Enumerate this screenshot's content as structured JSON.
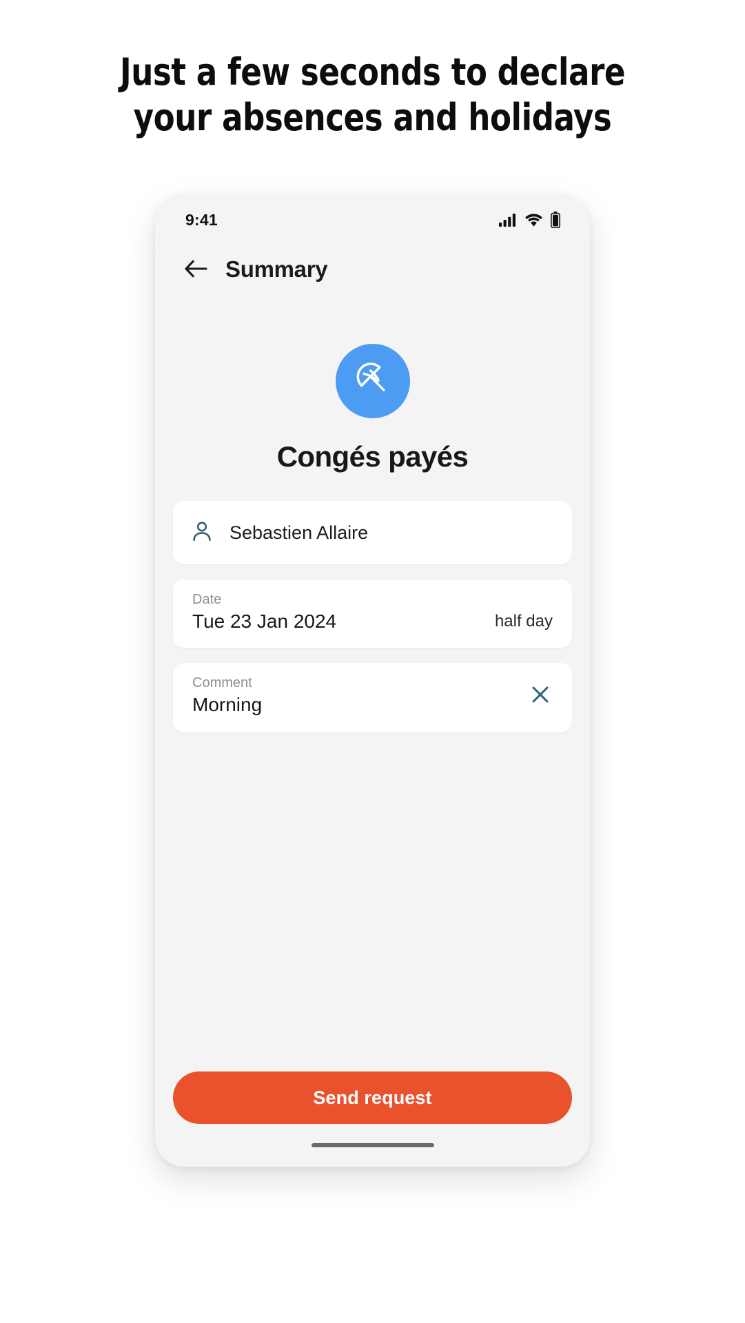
{
  "promo": {
    "headline_line1": "Just a few seconds to declare",
    "headline_line2": "your absences and holidays"
  },
  "phone": {
    "status_bar": {
      "time": "9:41",
      "icons": [
        "cellular-signal-icon",
        "wifi-icon",
        "battery-icon"
      ]
    },
    "header": {
      "back_icon": "back-arrow-icon",
      "title": "Summary"
    },
    "hero": {
      "badge_icon": "beach-parasol-icon",
      "badge_color": "#4b9cf2",
      "absence_type": "Congés payés"
    },
    "cards": {
      "person": {
        "icon": "person-icon",
        "icon_color": "#2f6171",
        "name": "Sebastien Allaire"
      },
      "date": {
        "label": "Date",
        "value": "Tue 23 Jan 2024",
        "duration": "half day"
      },
      "comment": {
        "label": "Comment",
        "value": "Morning",
        "clear_icon": "close-icon",
        "clear_icon_color": "#2f6171"
      }
    },
    "cta": {
      "label": "Send request",
      "color": "#e9522c"
    },
    "home_indicator": "home-indicator"
  }
}
